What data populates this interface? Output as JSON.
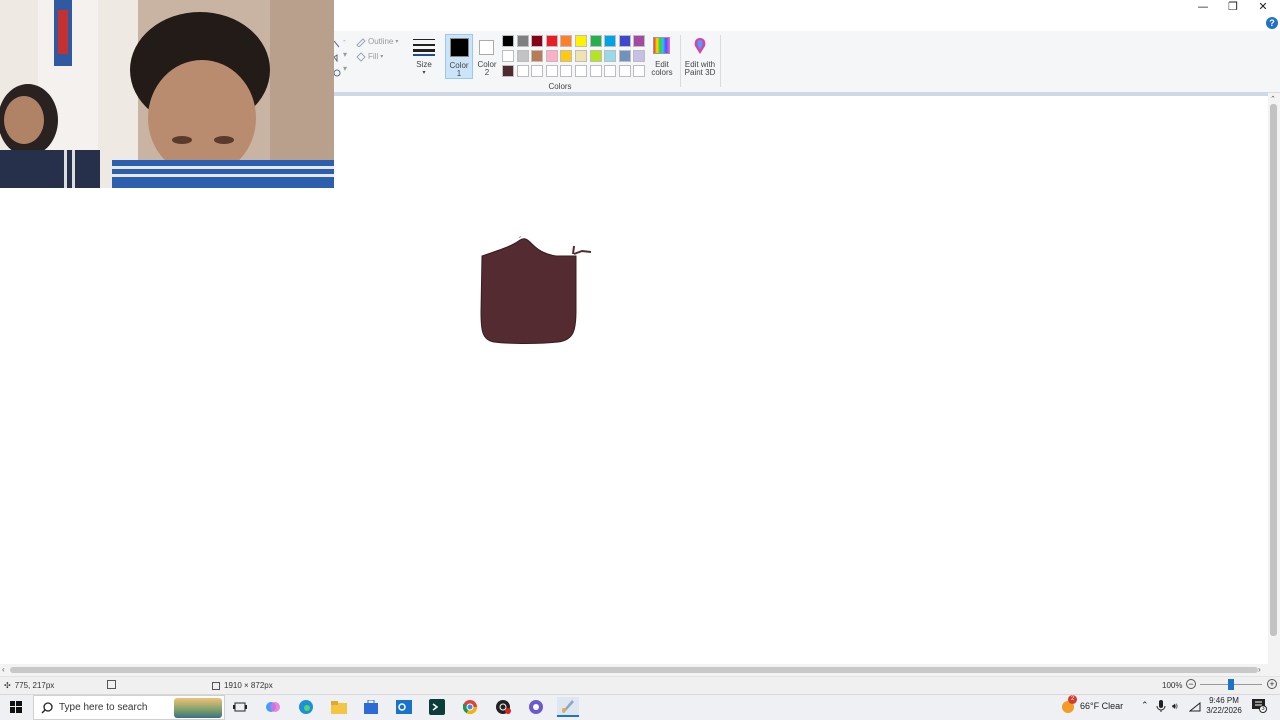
{
  "window": {
    "minimize_glyph": "—",
    "restore_glyph": "❐",
    "close_glyph": "✕",
    "help_glyph": "?"
  },
  "ribbon": {
    "shapes": {
      "outline_label": "Outline",
      "fill_label": "Fill"
    },
    "size_label": "Size",
    "color1_label_1": "Color",
    "color1_label_2": "1",
    "color2_label_1": "Color",
    "color2_label_2": "2",
    "edit_colors_1": "Edit",
    "edit_colors_2": "colors",
    "paint3d_1": "Edit with",
    "paint3d_2": "Paint 3D",
    "colors_group_label": "Colors",
    "palette_row1": [
      "#000000",
      "#7f7f7f",
      "#880015",
      "#ed1c24",
      "#ff7f27",
      "#fff200",
      "#22b14c",
      "#00a2e8",
      "#3f48cc",
      "#a349a4"
    ],
    "palette_row2": [
      "#ffffff",
      "#c3c3c3",
      "#b97a57",
      "#ffaec9",
      "#ffc90e",
      "#efe4b0",
      "#b5e61d",
      "#99d9ea",
      "#7092be",
      "#c8bfe7"
    ],
    "palette_row3": [
      "#4f2a30",
      "#ffffff",
      "#ffffff",
      "#ffffff",
      "#ffffff",
      "#ffffff",
      "#ffffff",
      "#ffffff",
      "#ffffff",
      "#ffffff"
    ],
    "color1_value": "#000000",
    "color2_value": "#ffffff"
  },
  "canvas": {
    "drawing_color": "#532b30"
  },
  "status": {
    "cursor_pos": "775, 217px",
    "canvas_size": "1910 × 872px",
    "zoom": "100%",
    "zoom_level": 0.5
  },
  "taskbar": {
    "search_placeholder": "Type here to search",
    "weather": "66°F  Clear",
    "weather_badge": "2",
    "time": "9:46 PM",
    "date": "3/22/2026",
    "notification_count": "3"
  }
}
